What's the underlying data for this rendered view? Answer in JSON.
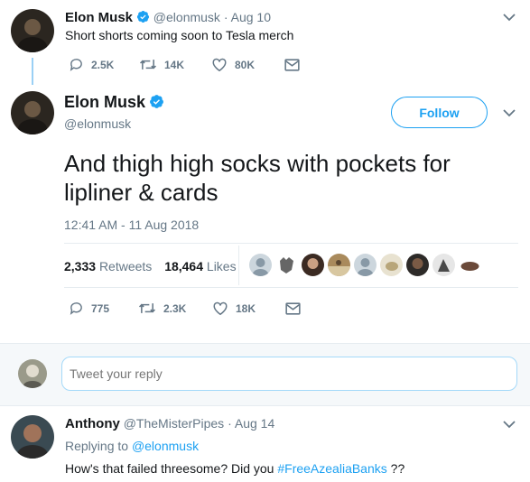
{
  "parent_tweet": {
    "name": "Elon Musk",
    "handle": "@elonmusk",
    "date": "Aug 10",
    "text": "Short shorts coming soon to Tesla merch",
    "replies": "2.5K",
    "retweets": "14K",
    "likes": "80K"
  },
  "main_tweet": {
    "name": "Elon Musk",
    "handle": "@elonmusk",
    "follow_label": "Follow",
    "text": "And thigh high socks with pockets for lipliner & cards",
    "timestamp": "12:41 AM - 11 Aug 2018",
    "retweet_count": "2,333",
    "retweet_label": "Retweets",
    "like_count": "18,464",
    "like_label": "Likes",
    "replies": "775",
    "retweets": "2.3K",
    "likes": "18K"
  },
  "reply_box": {
    "placeholder": "Tweet your reply"
  },
  "reply_tweet": {
    "name": "Anthony",
    "handle": "@TheMisterPipes",
    "date": "Aug 14",
    "replying_prefix": "Replying to",
    "replying_to": "@elonmusk",
    "text_before": "How's that failed threesome? Did you",
    "hashtag": "#FreeAzealiaBanks",
    "text_after": "??"
  },
  "colors": {
    "accent": "#1da1f2",
    "muted": "#657786",
    "text": "#14171a",
    "thread_line": "#9ad0f5",
    "reply_bar_bg": "#f5f8fa"
  },
  "icons": {
    "verified": "verified-badge-icon",
    "reply": "reply-bubble-icon",
    "retweet": "retweet-arrows-icon",
    "like": "heart-icon",
    "dm": "envelope-icon",
    "menu": "chevron-down-icon"
  }
}
